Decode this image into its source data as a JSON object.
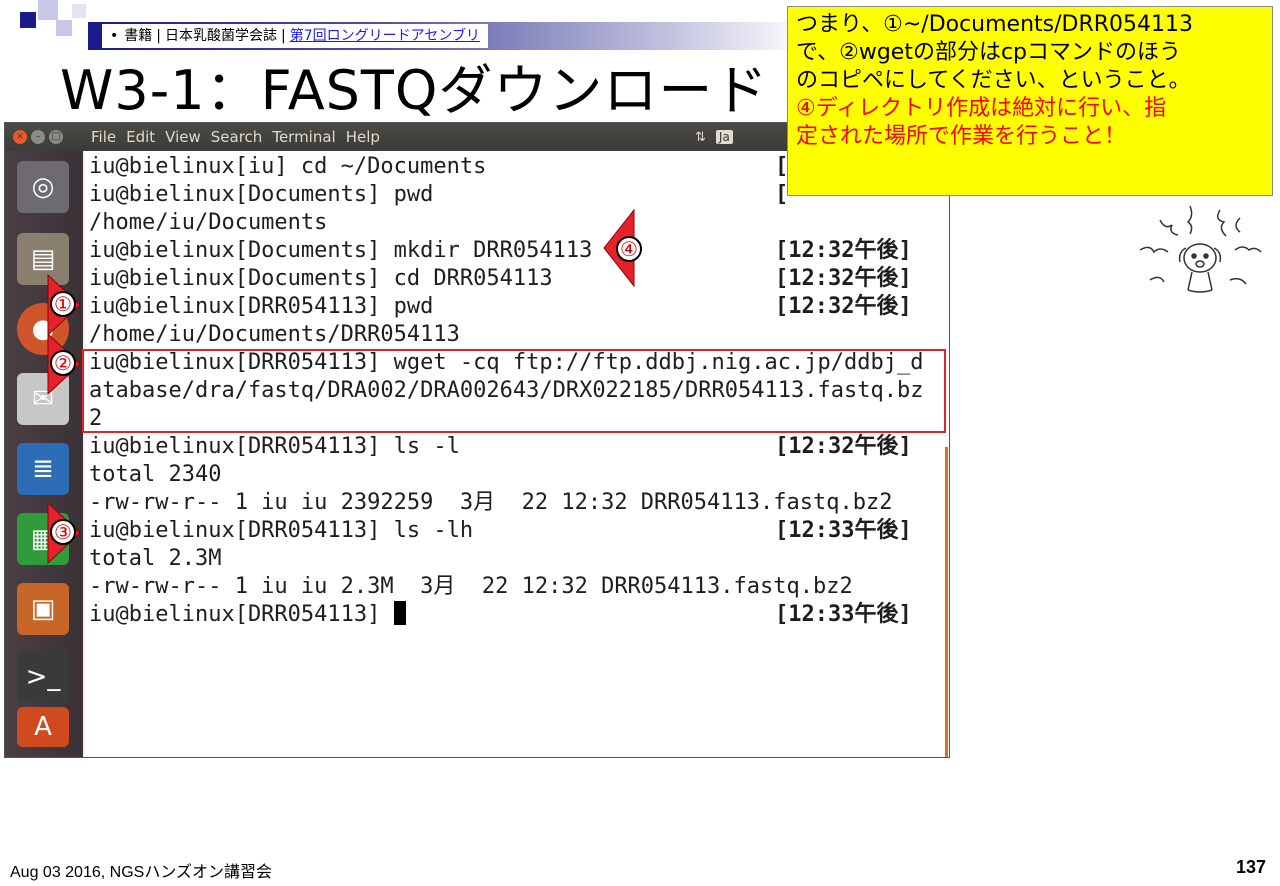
{
  "header": {
    "bullet": "•",
    "breadcrumb_1": "書籍",
    "sep_1": "|",
    "breadcrumb_2": "日本乳酸菌学会誌",
    "sep_2": "|",
    "breadcrumb_link": "第7回ロングリードアセンブリ"
  },
  "slide": {
    "title": "W3-1：FASTQダウンロード"
  },
  "callout": {
    "line1": "つまり、①~/Documents/DRR054113",
    "line2": "で、②wgetの部分はcpコマンドのほう",
    "line3": "のコピペにしてください、ということ。",
    "line4": "④ディレクトリ作成は絶対に行い、指",
    "line5": "定された場所で作業を行うこと！"
  },
  "window": {
    "menu": [
      "File",
      "Edit",
      "View",
      "Search",
      "Terminal",
      "Help"
    ],
    "tray": {
      "input_method": "Ja"
    }
  },
  "terminal": {
    "lines": [
      "iu@bielinux[iu] cd ~/Documents",
      "iu@bielinux[Documents] pwd",
      "/home/iu/Documents",
      "iu@bielinux[Documents] mkdir DRR054113",
      "iu@bielinux[Documents] cd DRR054113",
      "iu@bielinux[DRR054113] pwd",
      "/home/iu/Documents/DRR054113",
      "iu@bielinux[DRR054113] wget -cq ftp://ftp.ddbj.nig.ac.jp/ddbj_d",
      "atabase/dra/fastq/DRA002/DRA002643/DRX022185/DRR054113.fastq.bz",
      "2",
      "iu@bielinux[DRR054113] ls -l",
      "total 2340",
      "-rw-rw-r-- 1 iu iu 2392259  3月  22 12:32 DRR054113.fastq.bz2",
      "iu@bielinux[DRR054113] ls -lh",
      "total 2.3M",
      "-rw-rw-r-- 1 iu iu 2.3M  3月  22 12:32 DRR054113.fastq.bz2",
      "iu@bielinux[DRR054113] "
    ],
    "timestamps": [
      "[",
      "[",
      "",
      "[12:32午後]",
      "[12:32午後]",
      "[12:32午後]",
      "",
      "",
      "",
      "",
      "[12:32午後]",
      "",
      "",
      "[12:33午後]",
      "",
      "",
      "[12:33午後]"
    ]
  },
  "markers": {
    "m1": "①",
    "m2": "②",
    "m3": "③",
    "m4": "④"
  },
  "colors": {
    "accent_red": "#e5222b",
    "callout_bg": "#ffff00",
    "titlebar": "#3c3b37"
  },
  "footer": {
    "text": "Aug 03 2016, NGSハンズオン講習会",
    "page": "137"
  }
}
